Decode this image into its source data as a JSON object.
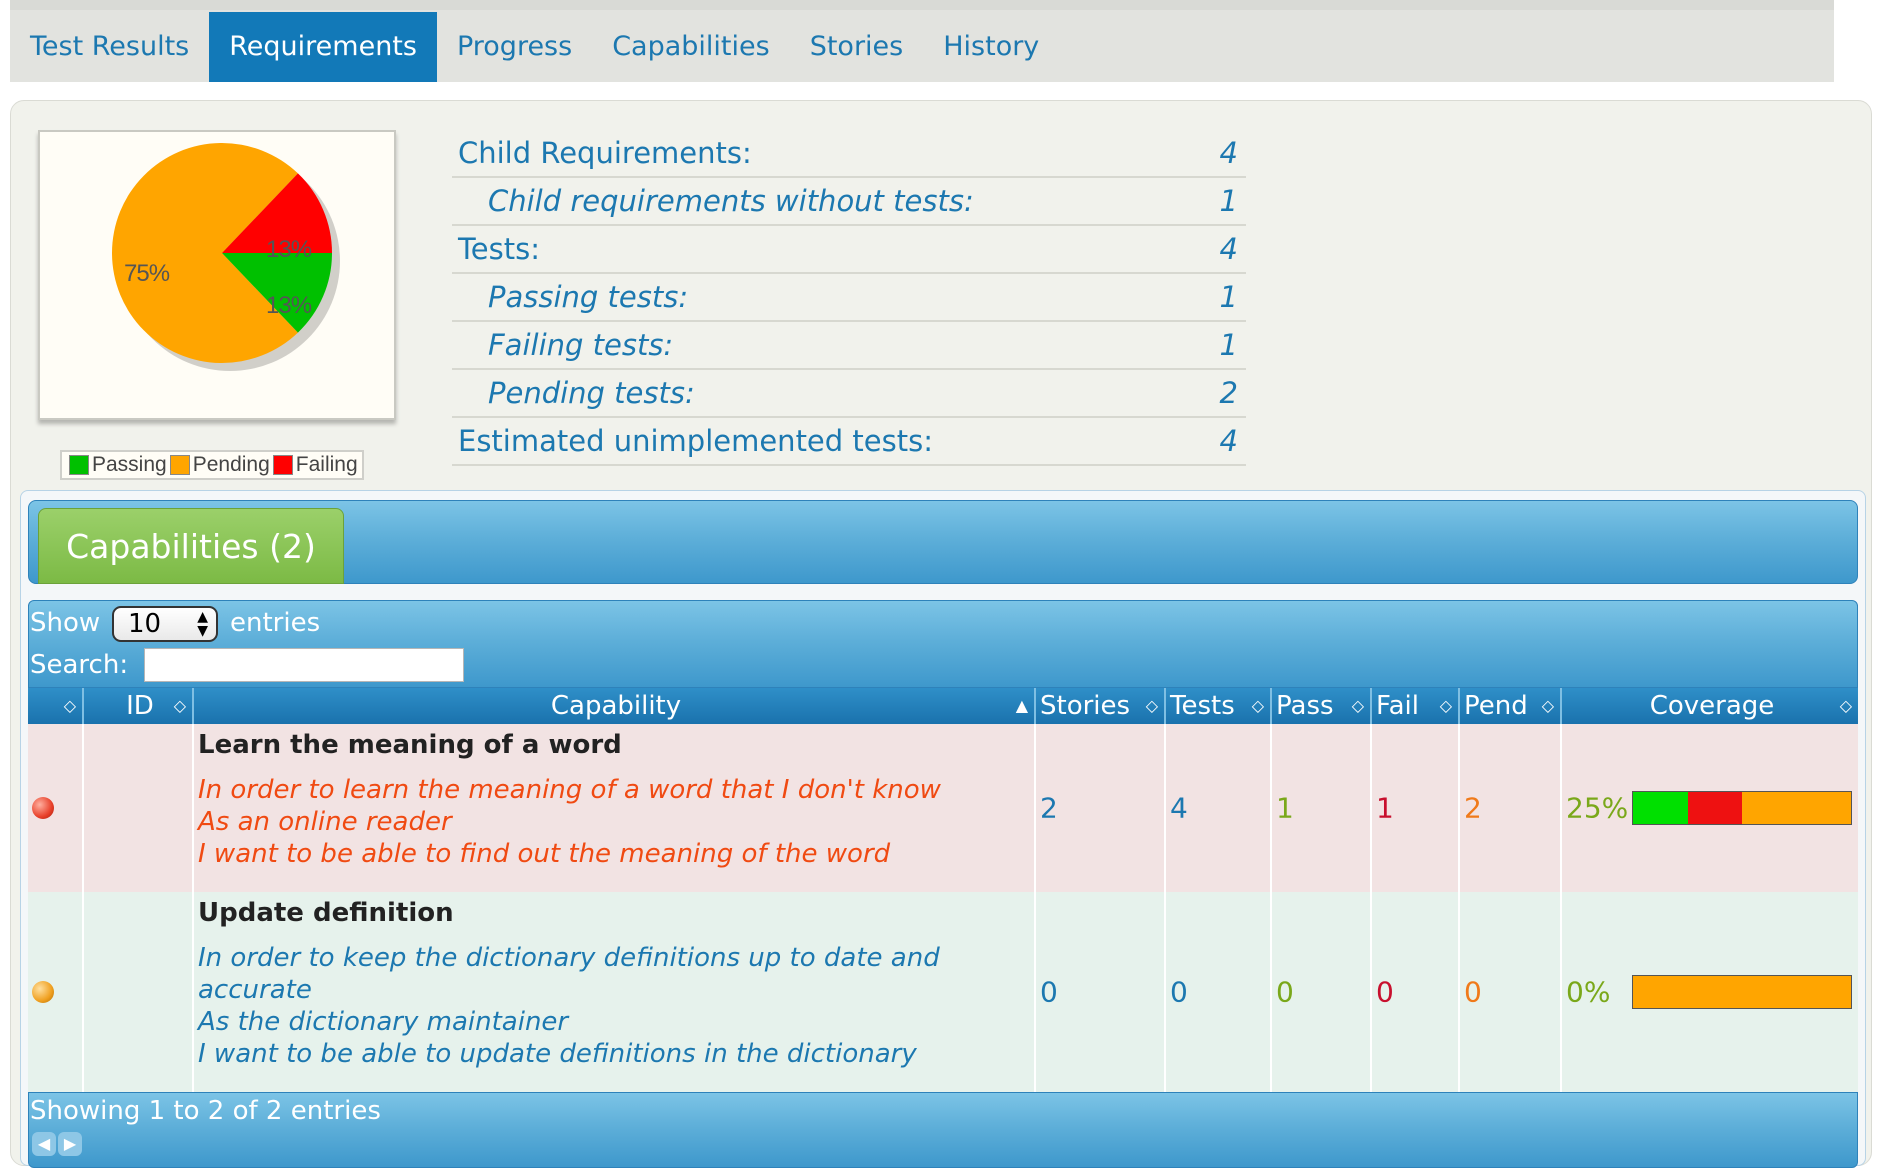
{
  "tabs": [
    {
      "label": "Test Results"
    },
    {
      "label": "Requirements",
      "active": true
    },
    {
      "label": "Progress"
    },
    {
      "label": "Capabilities"
    },
    {
      "label": "Stories"
    },
    {
      "label": "History"
    }
  ],
  "pie": {
    "slices": [
      {
        "name": "Pending",
        "value": 75,
        "label": "75%",
        "color": "#ffa500"
      },
      {
        "name": "Failing",
        "value": 13,
        "label": "13%",
        "color": "#ff0000"
      },
      {
        "name": "Passing",
        "value": 13,
        "label": "13%",
        "color": "#00c000"
      }
    ],
    "legend": [
      {
        "label": "Passing",
        "color": "#00c000"
      },
      {
        "label": "Pending",
        "color": "#ffa500"
      },
      {
        "label": "Failing",
        "color": "#ff0000"
      }
    ]
  },
  "stats": [
    {
      "label": "Child Requirements:",
      "value": "4",
      "sub": false
    },
    {
      "label": "Child requirements without tests:",
      "value": "1",
      "sub": true
    },
    {
      "label": "Tests:",
      "value": "4",
      "sub": false
    },
    {
      "label": "Passing tests:",
      "value": "1",
      "sub": true
    },
    {
      "label": "Failing tests:",
      "value": "1",
      "sub": true
    },
    {
      "label": "Pending tests:",
      "value": "2",
      "sub": true
    },
    {
      "label": "Estimated unimplemented tests:",
      "value": "4",
      "sub": false
    }
  ],
  "capabilities_tab": "Capabilities (2)",
  "controls": {
    "show_label": "Show",
    "entries_value": "10",
    "entries_label": "entries",
    "search_label": "Search:",
    "search_value": ""
  },
  "table": {
    "headers": [
      "",
      "ID",
      "Capability",
      "Stories",
      "Tests",
      "Pass",
      "Fail",
      "Pend",
      "Coverage"
    ],
    "rows": [
      {
        "status": "failure",
        "status_color": "#e8402a",
        "id": "",
        "title": "Learn the meaning of a word",
        "narrative": [
          "In order to learn the meaning of a word that I don't know",
          "As an online reader",
          "I want to be able to find out the meaning of the word"
        ],
        "narrative_color": "#f04a12",
        "stories": "2",
        "tests": "4",
        "pass": "1",
        "fail": "1",
        "pend": "2",
        "coverage": "25%",
        "bar": {
          "pass": 0.25,
          "fail": 0.25,
          "pending": 0.5
        }
      },
      {
        "status": "pending",
        "status_color": "#f0a020",
        "id": "",
        "title": "Update definition",
        "narrative": [
          "In order to keep the dictionary definitions up to date and",
          "accurate",
          "As the dictionary maintainer",
          "I want to be able to update definitions in the dictionary"
        ],
        "narrative_color": "#1c78b0",
        "stories": "0",
        "tests": "0",
        "pass": "0",
        "fail": "0",
        "pend": "0",
        "coverage": "0%",
        "bar": {
          "pass": 0,
          "fail": 0,
          "pending": 1
        }
      }
    ]
  },
  "footer": {
    "info": "Showing 1 to 2 of 2 entries"
  },
  "colors": {
    "link": "#1c78b0",
    "pass": "#7aa81a",
    "fail": "#c8102e",
    "pend": "#f07a1a",
    "coverage_text": "#7aa81a"
  }
}
